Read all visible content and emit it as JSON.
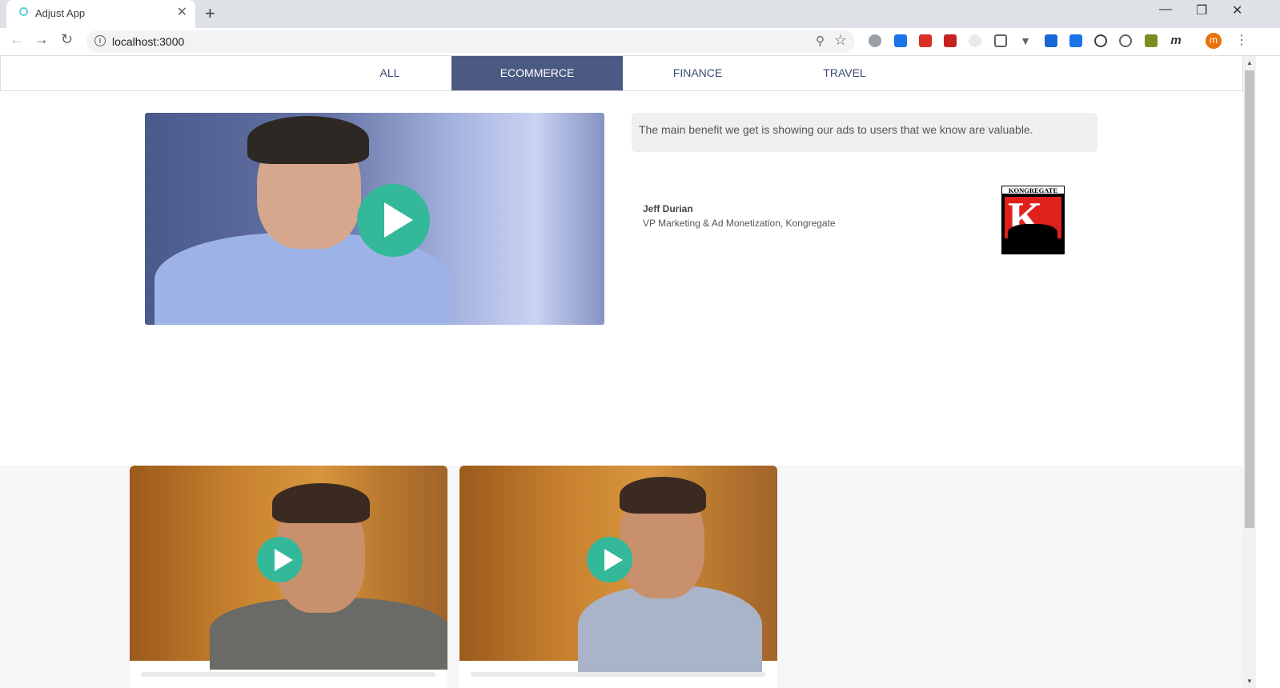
{
  "browser": {
    "tab_title": "Adjust App",
    "tab_close": "✕",
    "new_tab": "+",
    "url": "localhost:3000",
    "window_controls": [
      "—",
      "❐",
      "✕"
    ],
    "profile_initial": "m"
  },
  "nav": {
    "items": [
      {
        "label": "ALL"
      },
      {
        "label": "ECOMMERCE"
      },
      {
        "label": "FINANCE"
      },
      {
        "label": "TRAVEL"
      }
    ],
    "active": "ECOMMERCE"
  },
  "featured": {
    "quote": "The main benefit we get is showing our ads to users that we know are valuable.",
    "person_name": "Jeff Durian",
    "person_role": "VP Marketing & Ad Monetization, Kongregate",
    "logo_text": "KONGREGATE",
    "logo_letter": "K"
  },
  "colors": {
    "accent": "#4b5a82",
    "play": "#33b89a",
    "nav_text": "#3b4a73"
  }
}
